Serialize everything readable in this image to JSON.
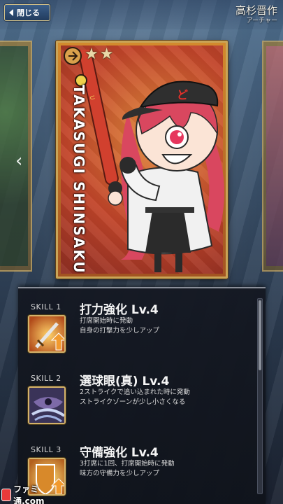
{
  "header": {
    "close_label": "閉じる",
    "servant_name": "高杉晋作",
    "servant_class": "アーチャー"
  },
  "card": {
    "stars": [
      "★",
      "★"
    ],
    "vertical_name": "TAKASUGI SHINSAKU",
    "icons": {
      "class_emblem": "archer-class-icon",
      "bat": "baseball-bat-icon"
    }
  },
  "skills": [
    {
      "tag": "SKILL 1",
      "title": "打力強化 Lv.4",
      "desc1": "打席開始時に発動",
      "desc2": "自身の打撃力を少しアップ",
      "icon": "sword-up-icon"
    },
    {
      "tag": "SKILL 2",
      "title": "選球眼(真) Lv.4",
      "desc1": "2ストライクで追い込まれた時に発動",
      "desc2": "ストライクゾーンが少し小さくなる",
      "icon": "eye-mode-icon"
    },
    {
      "tag": "SKILL 3",
      "title": "守備強化 Lv.4",
      "desc1": "3打席に1回、打席開始時に発動",
      "desc2": "味方の守備力を少しアップ",
      "icon": "shield-up-icon"
    }
  ],
  "watermark": {
    "text": "ファミ通.com"
  },
  "colors": {
    "accent_gold": "#d3b26a",
    "panel_bg": "#141822",
    "card_bg": "#c2452a"
  }
}
